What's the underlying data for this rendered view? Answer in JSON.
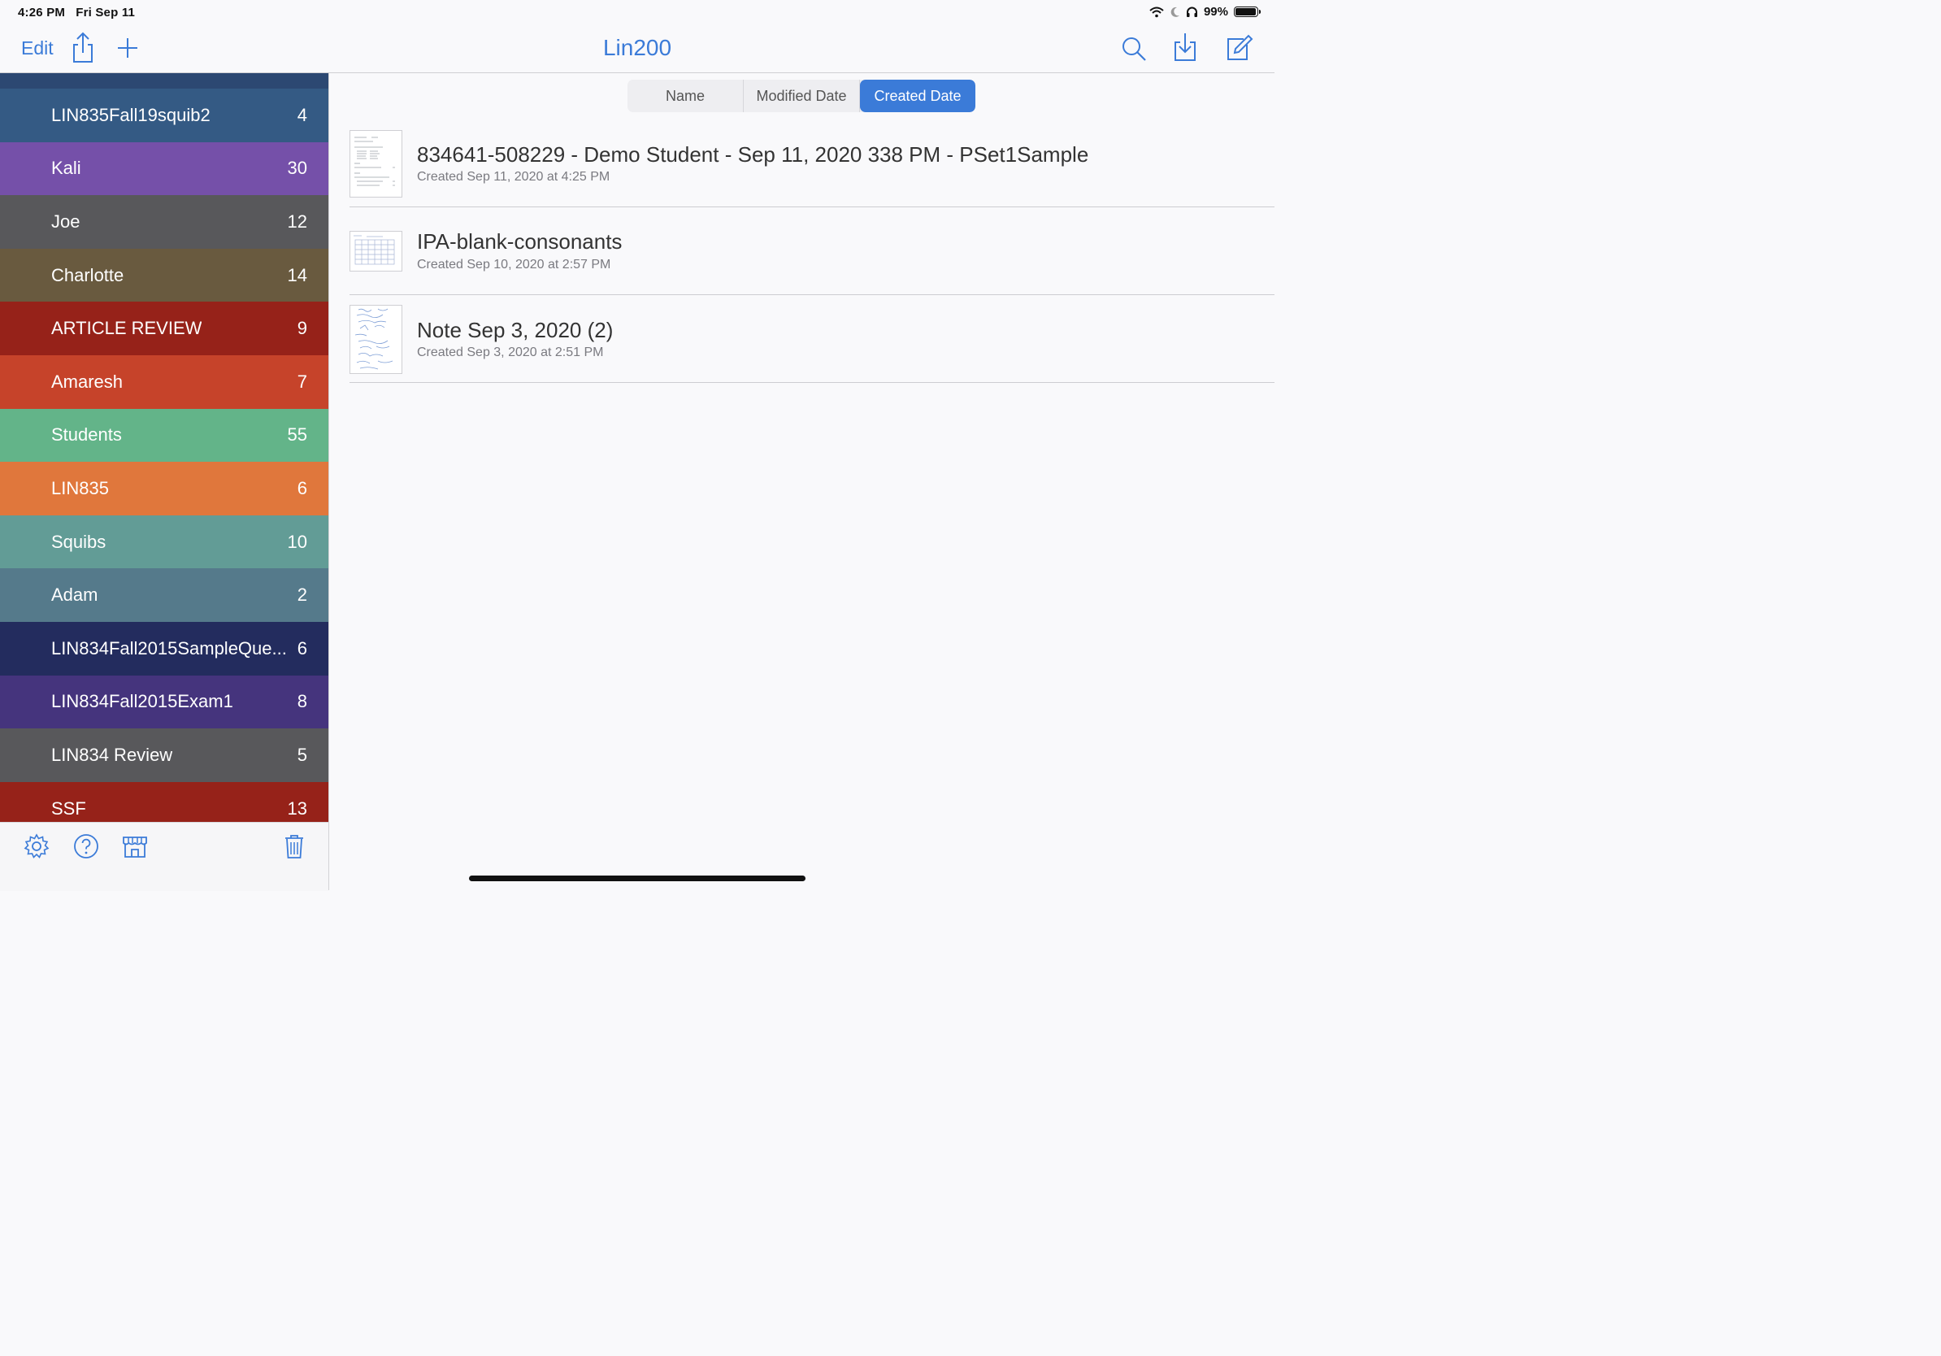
{
  "status_bar": {
    "time": "4:26 PM",
    "date": "Fri Sep 11",
    "battery": "99%",
    "battery_level": 0.99,
    "icons": [
      "wifi-icon",
      "moon-icon",
      "headphones-icon",
      "battery-icon"
    ]
  },
  "nav": {
    "edit_label": "Edit",
    "title": "Lin200",
    "left_icons": [
      "share-icon",
      "plus-icon"
    ],
    "right_icons": [
      "search-icon",
      "import-icon",
      "compose-icon"
    ],
    "accent_color": "#3b7bd8"
  },
  "sidebar": {
    "folders": [
      {
        "name": "LIN835Fall19squib2",
        "count": "4",
        "color": "#345a84"
      },
      {
        "name": "Kali",
        "count": "30",
        "color": "#7550a9"
      },
      {
        "name": "Joe",
        "count": "12",
        "color": "#58585b"
      },
      {
        "name": "Charlotte",
        "count": "14",
        "color": "#695a3f"
      },
      {
        "name": "ARTICLE REVIEW",
        "count": "9",
        "color": "#962219"
      },
      {
        "name": "Amaresh",
        "count": "7",
        "color": "#c6432a"
      },
      {
        "name": "Students",
        "count": "55",
        "color": "#63b489"
      },
      {
        "name": "LIN835",
        "count": "6",
        "color": "#e0773c"
      },
      {
        "name": "Squibs",
        "count": "10",
        "color": "#629c96"
      },
      {
        "name": "Adam",
        "count": "2",
        "color": "#557a8b"
      },
      {
        "name": "LIN834Fall2015SampleQue...",
        "count": "6",
        "color": "#232c5e"
      },
      {
        "name": "LIN834Fall2015Exam1",
        "count": "8",
        "color": "#45347d"
      },
      {
        "name": "LIN834 Review",
        "count": "5",
        "color": "#58585b"
      },
      {
        "name": "SSF",
        "count": "13",
        "color": "#962219"
      }
    ],
    "toolbar_icons": [
      "settings-icon",
      "help-icon",
      "store-icon",
      "trash-icon"
    ]
  },
  "sort": {
    "options": [
      "Name",
      "Modified Date",
      "Created Date"
    ],
    "selected": "Created Date"
  },
  "documents": [
    {
      "title": "834641-508229 - Demo Student - Sep 11, 2020 338 PM - PSet1Sample",
      "subtitle": "Created Sep 11, 2020 at 4:25 PM"
    },
    {
      "title": "IPA-blank-consonants",
      "subtitle": "Created Sep 10, 2020 at 2:57 PM"
    },
    {
      "title": "Note Sep 3, 2020 (2)",
      "subtitle": "Created Sep 3, 2020 at 2:51 PM"
    }
  ]
}
